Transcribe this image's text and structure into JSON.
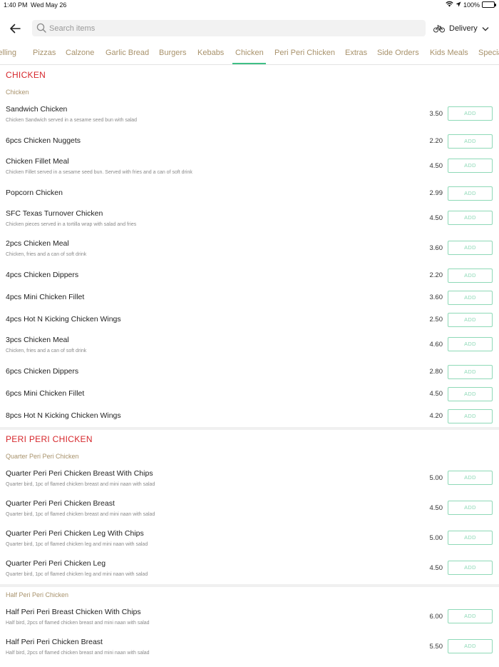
{
  "status_bar": {
    "time": "1:40 PM",
    "date": "Wed May 26",
    "battery": "100%",
    "battery_fraction": 1.0
  },
  "search": {
    "placeholder": "Search items",
    "value": ""
  },
  "delivery": {
    "label": "Delivery"
  },
  "tabs": [
    {
      "label": "Selling"
    },
    {
      "label": "Pizzas"
    },
    {
      "label": "Calzone"
    },
    {
      "label": "Garlic Bread"
    },
    {
      "label": "Burgers"
    },
    {
      "label": "Kebabs"
    },
    {
      "label": "Chicken"
    },
    {
      "label": "Peri Peri Chicken"
    },
    {
      "label": "Extras"
    },
    {
      "label": "Side Orders"
    },
    {
      "label": "Kids Meals"
    },
    {
      "label": "Special"
    }
  ],
  "active_tab": "Chicken",
  "add_label": "ADD",
  "sections": {
    "chicken": {
      "title": "CHICKEN",
      "subtitle": "Chicken",
      "items": [
        {
          "name": "Sandwich Chicken",
          "desc": "Chicken Sandwich served in a sesame seed bun with salad",
          "price": "3.50"
        },
        {
          "name": "6pcs Chicken Nuggets",
          "desc": "",
          "price": "2.20"
        },
        {
          "name": "Chicken Fillet Meal",
          "desc": "Chicken Fillet served in a sesame seed bun. Served with fries and a can of soft drink",
          "price": "4.50"
        },
        {
          "name": "Popcorn Chicken",
          "desc": "",
          "price": "2.99"
        },
        {
          "name": "SFC Texas Turnover Chicken",
          "desc": "Chicken pieces served in a tortilla wrap with salad and fries",
          "price": "4.50"
        },
        {
          "name": "2pcs Chicken Meal",
          "desc": "Chicken, fries and a can of soft drink",
          "price": "3.60"
        },
        {
          "name": "4pcs Chicken Dippers",
          "desc": "",
          "price": "2.20"
        },
        {
          "name": "4pcs Mini Chicken Fillet",
          "desc": "",
          "price": "3.60"
        },
        {
          "name": "4pcs Hot N Kicking Chicken Wings",
          "desc": "",
          "price": "2.50"
        },
        {
          "name": "3pcs Chicken Meal",
          "desc": "Chicken, fries and a can of soft drink",
          "price": "4.60"
        },
        {
          "name": "6pcs Chicken Dippers",
          "desc": "",
          "price": "2.80"
        },
        {
          "name": "6pcs Mini Chicken Fillet",
          "desc": "",
          "price": "4.50"
        },
        {
          "name": "8pcs Hot N Kicking Chicken Wings",
          "desc": "",
          "price": "4.20"
        }
      ]
    },
    "peri": {
      "title": "PERI PERI CHICKEN",
      "quarter": {
        "subtitle": "Quarter Peri Peri Chicken",
        "items": [
          {
            "name": "Quarter Peri Peri Chicken Breast With Chips",
            "desc": "Quarter bird, 1pc of flamed chicken breast and mini naan with salad",
            "price": "5.00"
          },
          {
            "name": "Quarter Peri Peri Chicken Breast",
            "desc": "Quarter bird, 1pc of flamed chicken breast and mini naan with salad",
            "price": "4.50"
          },
          {
            "name": "Quarter Peri Peri Chicken Leg With Chips",
            "desc": "Quarter bird, 1pc of flamed chicken leg and mini naan with salad",
            "price": "5.00"
          },
          {
            "name": "Quarter Peri Peri Chicken Leg",
            "desc": "Quarter bird, 1pc of flamed chicken leg and mini naan with salad",
            "price": "4.50"
          }
        ]
      },
      "half": {
        "subtitle": "Half Peri Peri Chicken",
        "items": [
          {
            "name": "Half Peri Peri Breast Chicken With Chips",
            "desc": "Half bird, 2pcs of flamed chicken breast and mini naan with salad",
            "price": "6.00"
          },
          {
            "name": "Half Peri Peri Chicken Breast",
            "desc": "Half bird, 2pcs of flamed chicken breast and mini naan with salad",
            "price": "5.50"
          }
        ]
      }
    }
  },
  "colors": {
    "section_title": "#d6262b",
    "subtitle": "#a8926b",
    "tab_text": "#a8926b",
    "tab_underline": "#3fbf86",
    "add_button": "#8ed9b7"
  }
}
